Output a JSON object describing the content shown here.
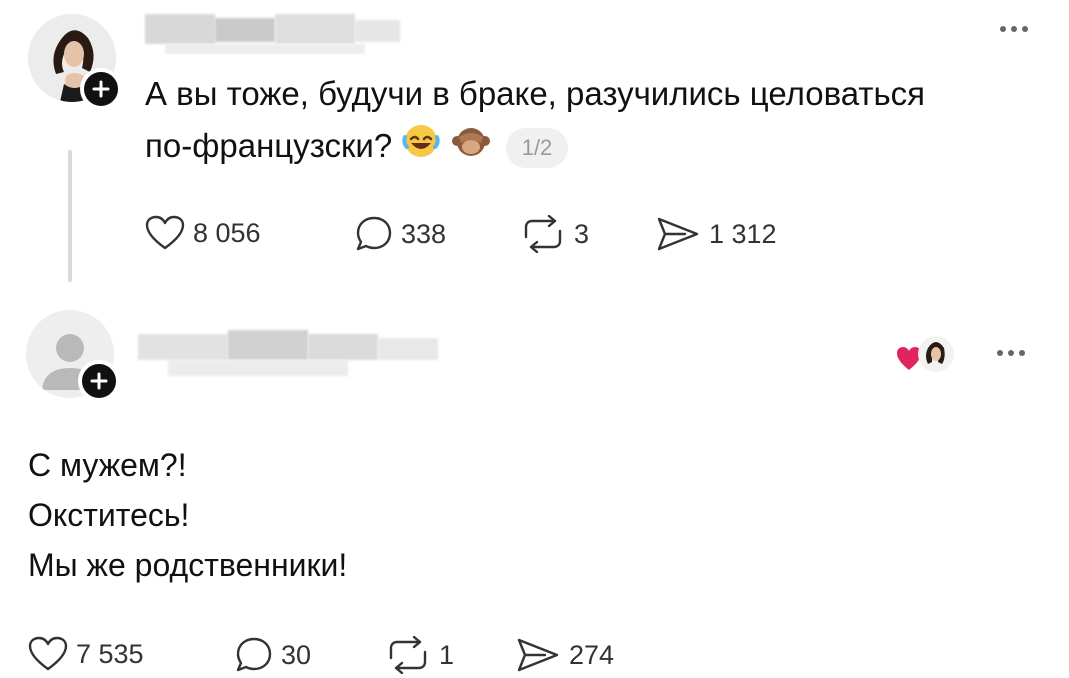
{
  "post": {
    "text_line1": "А вы тоже, будучи в браке, разучились целоваться",
    "text_line2": "по-французски?",
    "page_indicator": "1/2",
    "emojis": [
      "tears-of-joy-emoji",
      "see-no-evil-monkey-emoji"
    ],
    "stats": {
      "likes": "8 056",
      "comments": "338",
      "reposts": "3",
      "shares": "1 312"
    }
  },
  "reply": {
    "lines": [
      "С мужем?!",
      "Окститесь!",
      "Мы же родственники!"
    ],
    "stats": {
      "likes": "7 535",
      "comments": "30",
      "reposts": "1",
      "shares": "274"
    }
  },
  "icons": {
    "like": "heart-icon",
    "comment": "comment-bubble-icon",
    "repost": "repost-icon",
    "share": "send-icon",
    "more": "more-dots-icon",
    "follow": "plus-icon"
  },
  "colors": {
    "text": "#111111",
    "muted": "#9a9a9a",
    "line": "#d9d9d9",
    "heart": "#e0245e"
  }
}
